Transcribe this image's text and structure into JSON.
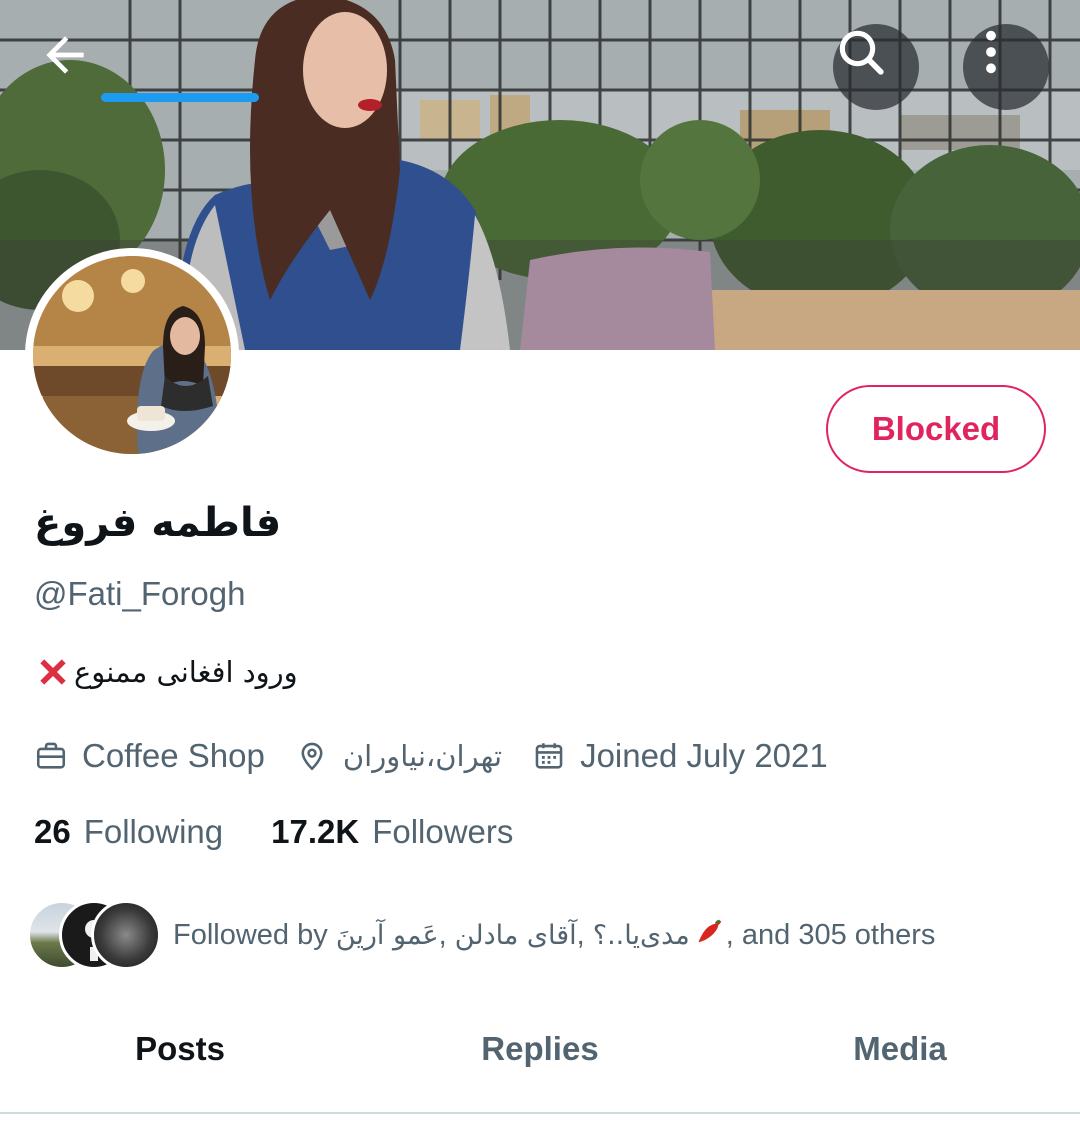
{
  "header": {
    "back_icon": "arrow-left-icon",
    "search_icon": "search-icon",
    "more_icon": "more-vertical-icon"
  },
  "profile": {
    "display_name": "فاطمه فروغ",
    "handle": "@Fati_Forogh",
    "bio": "ورود افغانی ممنوع",
    "bio_emoji": "cross-mark-emoji",
    "work": "Coffee Shop",
    "location": "تهران،نیاوران",
    "joined": "Joined July 2021",
    "following_count": "26",
    "following_label": "Following",
    "followers_count": "17.2K",
    "followers_label": "Followers"
  },
  "actions": {
    "blocked_label": "Blocked"
  },
  "followed_by": {
    "prefix": "Followed by",
    "names_fa_1": "عَمو آرینَ",
    "names_fa_2": "آقای مادلن",
    "names_fa_3": "مدی‌یا..؟",
    "pepper": "🌶",
    "suffix": ", and 305 others"
  },
  "tabs": [
    {
      "label": "Posts",
      "active": true
    },
    {
      "label": "Replies",
      "active": false
    },
    {
      "label": "Media",
      "active": false
    }
  ],
  "colors": {
    "blocked_red": "#e0245e",
    "accent_blue": "#1d9bf0",
    "secondary_text": "#536471"
  }
}
